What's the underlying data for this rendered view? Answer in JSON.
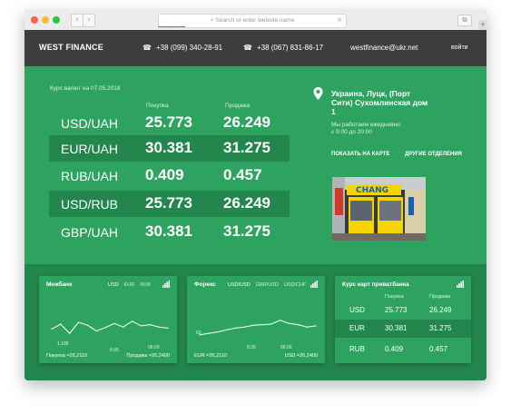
{
  "browser": {
    "url_placeholder": "Search or enter website name",
    "nav_back": "‹",
    "nav_forward": "›",
    "tabs_glyph": "⧉",
    "new_tab": "+"
  },
  "header": {
    "logo": "WEST FINANCE",
    "phone1": "+38 (099) 340-28-91",
    "phone2": "+38 (067) 831-86-17",
    "email": "westfinance@ukr.net",
    "login": "войти"
  },
  "rates": {
    "date_label": "Курс валют на 07.05.2018",
    "buy_label": "Покупка",
    "sell_label": "Продажа",
    "rows": [
      {
        "pair": "USD/UAH",
        "buy": "25.773",
        "sell": "26.249"
      },
      {
        "pair": "EUR/UAH",
        "buy": "30.381",
        "sell": "31.275"
      },
      {
        "pair": "RUB/UAH",
        "buy": "0.409",
        "sell": "0.457"
      },
      {
        "pair": "USD/RUB",
        "buy": "25.773",
        "sell": "26.249"
      },
      {
        "pair": "GBP/UAH",
        "buy": "30.381",
        "sell": "31.275"
      }
    ]
  },
  "branch": {
    "address": "Украина, Луцк, (Порт Сити) Сухомлинская дом 1",
    "hours_line1": "Мы работаем ежедневно:",
    "hours_line2": "с 9:00 до 20:00",
    "show_on_map": "ПОКАЗАТЬ НА КАРТЕ",
    "other_branches": "ДРУГИЕ ОТДЕЛЕНИЯ",
    "photo_sign": "CHANG"
  },
  "cards": {
    "interbank": {
      "title": "Межбанк",
      "tabs": [
        "USD",
        "EUR",
        "RUB"
      ],
      "active_tab": "USD",
      "low_label": "1,185",
      "date_label": "8.05",
      "time_label": "08.00",
      "buy_footer": "Покупка =26,2110",
      "sell_footer": "Продажа =26,2400",
      "series": [
        0.55,
        0.72,
        0.4,
        0.78,
        0.68,
        0.48,
        0.6,
        0.74,
        0.62,
        0.82,
        0.66,
        0.7,
        0.62,
        0.58
      ]
    },
    "forex": {
      "title": "Форекс",
      "tabs": [
        "USD/USD",
        "GBR/USD",
        "USD/CHF"
      ],
      "active_tab": "USD/USD",
      "low_label": "63",
      "date_label": "8.05",
      "time_label": "08.00",
      "buy_footer": "EUR =26,2110",
      "sell_footer": "USD =26,2400",
      "series": [
        0.35,
        0.4,
        0.45,
        0.52,
        0.58,
        0.62,
        0.68,
        0.7,
        0.72,
        0.85,
        0.74,
        0.7,
        0.62,
        0.66
      ]
    },
    "privatbank": {
      "title": "Курс карт приватбанка",
      "buy_label": "Покупка",
      "sell_label": "Продажа",
      "rows": [
        {
          "cur": "USD",
          "buy": "25.773",
          "sell": "26.249"
        },
        {
          "cur": "EUR",
          "buy": "30.381",
          "sell": "31.275"
        },
        {
          "cur": "RUB",
          "buy": "0.409",
          "sell": "0.457"
        }
      ]
    }
  },
  "colors": {
    "green": "#2ea35f",
    "dark_green": "#23864d",
    "header_dark": "#3d3d3d",
    "sign_yellow": "#f5d400"
  }
}
